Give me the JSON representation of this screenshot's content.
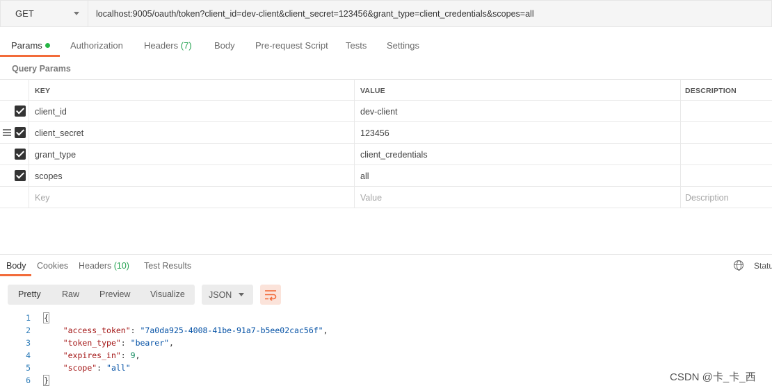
{
  "request": {
    "method": "GET",
    "url": "localhost:9005/oauth/token?client_id=dev-client&client_secret=123456&grant_type=client_credentials&scopes=all"
  },
  "request_tabs": {
    "params": "Params",
    "authorization": "Authorization",
    "headers": "Headers",
    "headers_count": "(7)",
    "body": "Body",
    "pre_request": "Pre-request Script",
    "tests": "Tests",
    "settings": "Settings"
  },
  "query_params": {
    "title": "Query Params",
    "columns": {
      "key": "KEY",
      "value": "VALUE",
      "description": "DESCRIPTION"
    },
    "rows": [
      {
        "key": "client_id",
        "value": "dev-client",
        "checked": true
      },
      {
        "key": "client_secret",
        "value": "123456",
        "checked": true
      },
      {
        "key": "grant_type",
        "value": "client_credentials",
        "checked": true
      },
      {
        "key": "scopes",
        "value": "all",
        "checked": true
      }
    ],
    "placeholders": {
      "key": "Key",
      "value": "Value",
      "description": "Description"
    }
  },
  "response_tabs": {
    "body": "Body",
    "cookies": "Cookies",
    "headers": "Headers",
    "headers_count": "(10)",
    "test_results": "Test Results",
    "status": "Statu"
  },
  "format_bar": {
    "pretty": "Pretty",
    "raw": "Raw",
    "preview": "Preview",
    "visualize": "Visualize",
    "language": "JSON"
  },
  "response_body": {
    "line_numbers": [
      "1",
      "2",
      "3",
      "4",
      "5",
      "6"
    ],
    "open": "{",
    "close": "}",
    "fields": [
      {
        "key": "\"access_token\"",
        "value": "\"7a0da925-4008-41be-91a7-b5ee02cac56f\"",
        "kind": "string",
        "comma": ","
      },
      {
        "key": "\"token_type\"",
        "value": "\"bearer\"",
        "kind": "string",
        "comma": ","
      },
      {
        "key": "\"expires_in\"",
        "value": "9",
        "kind": "number",
        "comma": ","
      },
      {
        "key": "\"scope\"",
        "value": "\"all\"",
        "kind": "string",
        "comma": ""
      }
    ]
  },
  "watermark": "CSDN @卡_卡_西",
  "colors": {
    "accent": "#f26b3a",
    "green_dot": "#26b545",
    "count_green": "#26a352"
  }
}
